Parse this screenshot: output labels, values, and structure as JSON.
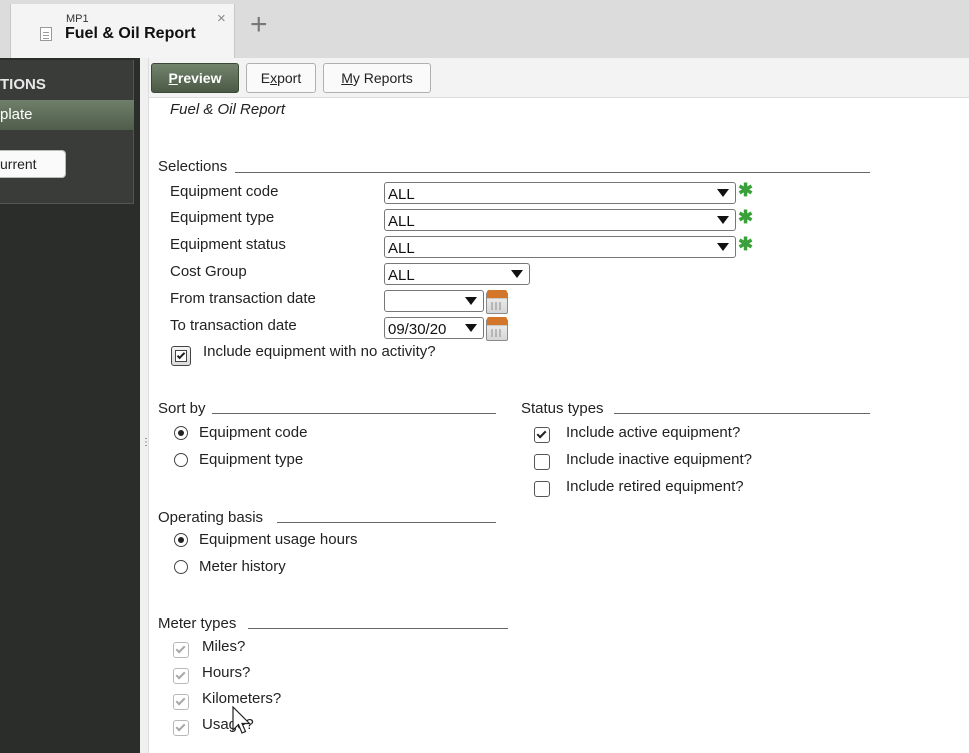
{
  "tab": {
    "subtitle": "MP1",
    "title": "Fuel & Oil Report",
    "close": "×",
    "add": "+"
  },
  "sidebar": {
    "heading": "TIONS",
    "item": "plate",
    "button": "urrent"
  },
  "toolbar": {
    "preview": "Preview",
    "export": "Export",
    "my_reports": "My Reports"
  },
  "report_title": "Fuel & Oil Report",
  "selections": {
    "label": "Selections",
    "fields": [
      {
        "label": "Equipment code",
        "value": "ALL",
        "required": true
      },
      {
        "label": "Equipment type",
        "value": "ALL",
        "required": true
      },
      {
        "label": "Equipment status",
        "value": "ALL",
        "required": true
      },
      {
        "label": "Cost Group",
        "value": "ALL",
        "required": false
      },
      {
        "label": "From transaction date",
        "value": "",
        "calendar": true
      },
      {
        "label": "To transaction date",
        "value": "09/30/20",
        "calendar": true
      }
    ],
    "required_marker": "✱",
    "include_no_activity": {
      "label": "Include equipment with no activity?",
      "checked": true
    }
  },
  "sort_by": {
    "label": "Sort by",
    "options": [
      {
        "label": "Equipment code",
        "selected": true
      },
      {
        "label": "Equipment type",
        "selected": false
      }
    ]
  },
  "status_types": {
    "label": "Status types",
    "options": [
      {
        "label": "Include active equipment?",
        "checked": true
      },
      {
        "label": "Include inactive equipment?",
        "checked": false
      },
      {
        "label": "Include retired equipment?",
        "checked": false
      }
    ]
  },
  "operating_basis": {
    "label": "Operating basis",
    "options": [
      {
        "label": "Equipment usage hours",
        "selected": true
      },
      {
        "label": "Meter history",
        "selected": false
      }
    ]
  },
  "meter_types": {
    "label": "Meter types",
    "options": [
      {
        "label": "Miles?",
        "checked": true,
        "disabled": true
      },
      {
        "label": "Hours?",
        "checked": true,
        "disabled": true
      },
      {
        "label": "Kilometers?",
        "checked": true,
        "disabled": true
      },
      {
        "label": "Usage?",
        "checked": true,
        "disabled": true
      }
    ]
  }
}
